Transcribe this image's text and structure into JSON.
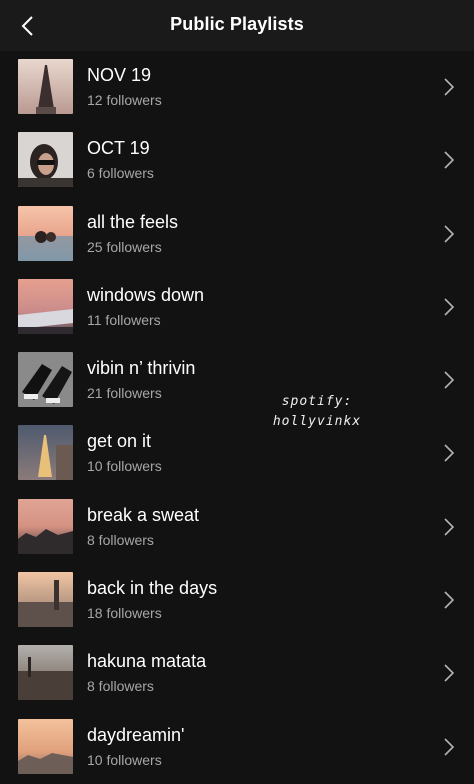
{
  "header": {
    "title": "Public Playlists",
    "back_icon": "chevron-left-icon"
  },
  "playlists": [
    {
      "title": "NOV 19",
      "followers": "12 followers"
    },
    {
      "title": "OCT 19",
      "followers": "6 followers"
    },
    {
      "title": "all the feels",
      "followers": "25 followers"
    },
    {
      "title": "windows down",
      "followers": "11 followers"
    },
    {
      "title": "vibin n’ thrivin",
      "followers": "21 followers"
    },
    {
      "title": "get on it",
      "followers": "10 followers"
    },
    {
      "title": "break a sweat",
      "followers": "8 followers"
    },
    {
      "title": "back in the days",
      "followers": "18 followers"
    },
    {
      "title": "hakuna matata",
      "followers": "8 followers"
    },
    {
      "title": "daydreamin'",
      "followers": "10 followers"
    }
  ],
  "watermark": {
    "line1": "spotify:",
    "line2": "hollyvinkx"
  },
  "colors": {
    "background": "#121212",
    "header": "#1a1a1a",
    "text": "#ffffff",
    "subtext": "#a7a7a7"
  }
}
